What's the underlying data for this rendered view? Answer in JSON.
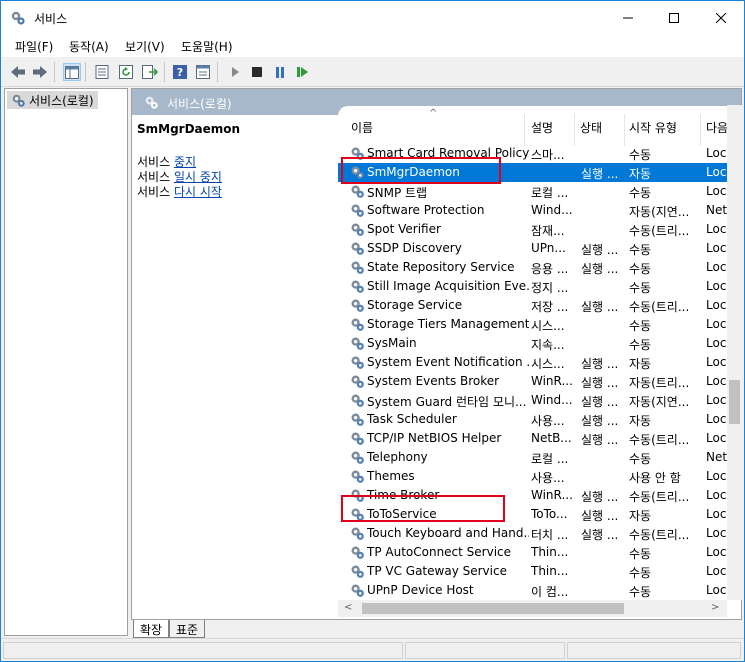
{
  "window": {
    "title": "서비스"
  },
  "menu": [
    "파일(F)",
    "동작(A)",
    "보기(V)",
    "도움말(H)"
  ],
  "toolbar_icons": [
    "back-arrow-icon",
    "forward-arrow-icon",
    "console-tree-icon",
    "properties-icon",
    "refresh-icon",
    "export-list-icon",
    "help-icon",
    "view-icon",
    "start-service-icon",
    "stop-service-icon",
    "pause-service-icon",
    "resume-service-icon"
  ],
  "tree": {
    "root_label": "서비스(로컬)"
  },
  "content": {
    "header_title": "서비스(로컬)",
    "selected_service": "SmMgrDaemon",
    "actions": [
      {
        "prefix": "서비스 ",
        "link": "중지"
      },
      {
        "prefix": "서비스 ",
        "link": "일시 중지"
      },
      {
        "prefix": "서비스 ",
        "link": "다시 시작"
      }
    ]
  },
  "columns": [
    "이름",
    "설명",
    "상태",
    "시작 유형",
    "다음"
  ],
  "services": [
    {
      "name": "Smart Card Removal Policy",
      "desc": "스마...",
      "status": "",
      "start": "수동",
      "logon": "Loc"
    },
    {
      "name": "SmMgrDaemon",
      "desc": "",
      "status": "실행 ...",
      "start": "자동",
      "logon": "Loc",
      "selected": true
    },
    {
      "name": "SNMP 트랩",
      "desc": "로컬 ...",
      "status": "",
      "start": "수동",
      "logon": "Loc"
    },
    {
      "name": "Software Protection",
      "desc": "Wind...",
      "status": "",
      "start": "자동(지연...",
      "logon": "Net"
    },
    {
      "name": "Spot Verifier",
      "desc": "잠재...",
      "status": "",
      "start": "수동(트리...",
      "logon": "Loc"
    },
    {
      "name": "SSDP Discovery",
      "desc": "UPn...",
      "status": "실행 ...",
      "start": "수동",
      "logon": "Loc"
    },
    {
      "name": "State Repository Service",
      "desc": "응용 ...",
      "status": "실행 ...",
      "start": "수동",
      "logon": "Loc"
    },
    {
      "name": "Still Image Acquisition Eve...",
      "desc": "정지 ...",
      "status": "",
      "start": "수동",
      "logon": "Loc"
    },
    {
      "name": "Storage Service",
      "desc": "저장 ...",
      "status": "실행 ...",
      "start": "수동(트리...",
      "logon": "Loc"
    },
    {
      "name": "Storage Tiers Management",
      "desc": "시스...",
      "status": "",
      "start": "수동",
      "logon": "Loc"
    },
    {
      "name": "SysMain",
      "desc": "지속...",
      "status": "",
      "start": "수동",
      "logon": "Loc"
    },
    {
      "name": "System Event Notification ...",
      "desc": "시스...",
      "status": "실행 ...",
      "start": "자동",
      "logon": "Loc"
    },
    {
      "name": "System Events Broker",
      "desc": "WinR...",
      "status": "실행 ...",
      "start": "자동(트리...",
      "logon": "Loc"
    },
    {
      "name": "System Guard 런타임 모니...",
      "desc": "Wind...",
      "status": "실행 ...",
      "start": "자동(지연...",
      "logon": "Loc"
    },
    {
      "name": "Task Scheduler",
      "desc": "사용...",
      "status": "실행 ...",
      "start": "자동",
      "logon": "Loc"
    },
    {
      "name": "TCP/IP NetBIOS Helper",
      "desc": "NetB...",
      "status": "실행 ...",
      "start": "수동(트리...",
      "logon": "Loc"
    },
    {
      "name": "Telephony",
      "desc": "로컬 ...",
      "status": "",
      "start": "수동",
      "logon": "Net"
    },
    {
      "name": "Themes",
      "desc": "사용...",
      "status": "",
      "start": "사용 안 함",
      "logon": "Loc"
    },
    {
      "name": "Time Broker",
      "desc": "WinR...",
      "status": "실행 ...",
      "start": "수동(트리...",
      "logon": "Loc"
    },
    {
      "name": "ToToService",
      "desc": "ToTo...",
      "status": "실행 ...",
      "start": "자동",
      "logon": "Loc"
    },
    {
      "name": "Touch Keyboard and Hand...",
      "desc": "터치 ...",
      "status": "실행 ...",
      "start": "수동(트리...",
      "logon": "Loc"
    },
    {
      "name": "TP AutoConnect Service",
      "desc": "Thin...",
      "status": "",
      "start": "수동",
      "logon": "Loc"
    },
    {
      "name": "TP VC Gateway Service",
      "desc": "Thin...",
      "status": "",
      "start": "수동",
      "logon": "Loc"
    },
    {
      "name": "UPnP Device Host",
      "desc": "이 컴...",
      "status": "",
      "start": "수동",
      "logon": "Loc"
    }
  ],
  "tabs": [
    "확장",
    "표준"
  ],
  "colors": {
    "selection": "#0078d7",
    "highlight_box": "#e0001b",
    "header_band": "#a7b8cb",
    "link": "#0645ad"
  }
}
